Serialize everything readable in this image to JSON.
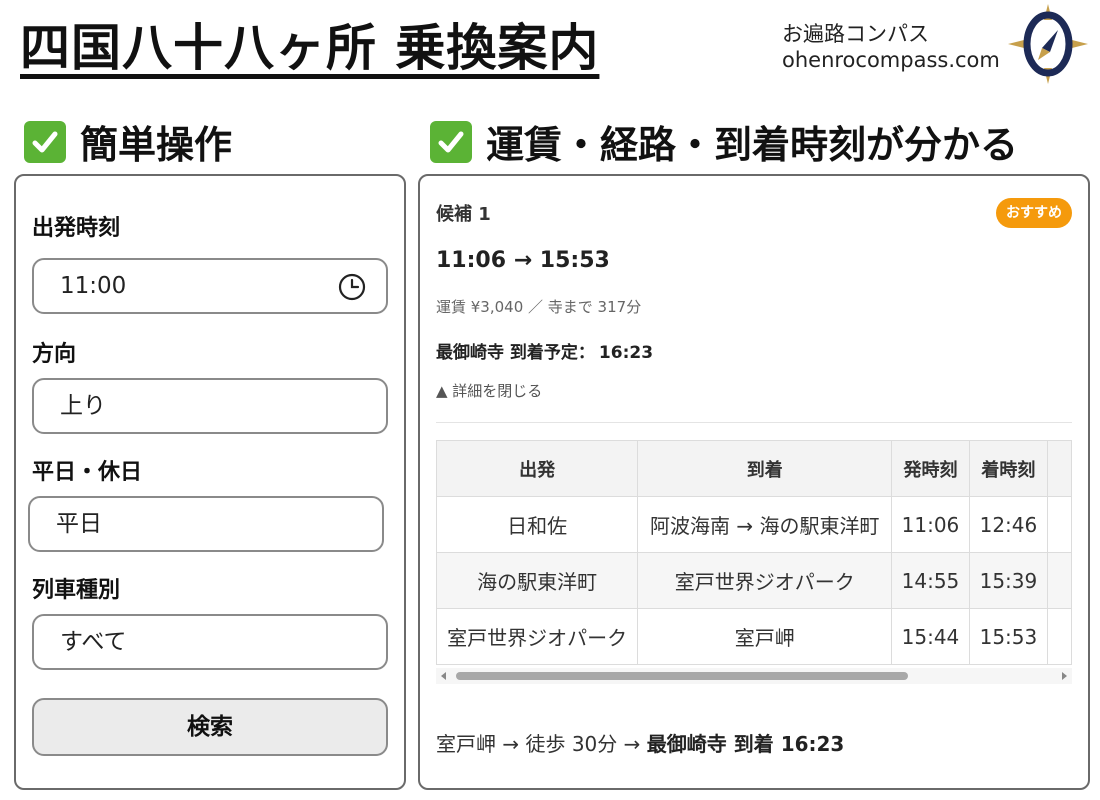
{
  "header": {
    "title": "四国八十八ヶ所 乗換案内",
    "brand_name": "お遍路コンパス",
    "brand_url": "ohenrocompass.com"
  },
  "sections": {
    "left_heading": "簡単操作",
    "right_heading": "運賃・経路・到着時刻が分かる"
  },
  "form": {
    "departure_time_label": "出発時刻",
    "departure_time_value": "11:00",
    "direction_label": "方向",
    "direction_value": "上り",
    "day_type_label": "平日・休日",
    "day_type_value": "平日",
    "train_type_label": "列車種別",
    "train_type_value": "すべて",
    "search_button": "検索"
  },
  "result": {
    "candidate_label": "候補 1",
    "badge": "おすすめ",
    "time_range": "11:06 → 15:53",
    "fare_info": "運賃 ¥3,040 ／ 寺まで 317分",
    "arrival_label": "最御崎寺 到着予定：",
    "arrival_time": "16:23",
    "details_toggle": "▲ 詳細を閉じる",
    "table": {
      "headers": [
        "出発",
        "到着",
        "発時刻",
        "着時刻"
      ],
      "rows": [
        [
          "日和佐",
          "阿波海南 → 海の駅東洋町",
          "11:06",
          "12:46"
        ],
        [
          "海の駅東洋町",
          "室戸世界ジオパーク",
          "14:55",
          "15:39"
        ],
        [
          "室戸世界ジオパーク",
          "室戸岬",
          "15:44",
          "15:53"
        ]
      ]
    },
    "footer_prefix": "室戸岬 → 徒歩 30分 →",
    "footer_bold": "最御崎寺 到着 16:23"
  },
  "colors": {
    "check_green": "#5bb335",
    "badge_orange": "#f59a0c",
    "logo_navy": "#1d2a56",
    "logo_gold": "#c7a04c"
  },
  "icons": [
    "checkbox-check-icon",
    "clock-icon",
    "compass-logo-icon",
    "scroll-left-arrow-icon",
    "scroll-right-arrow-icon"
  ]
}
